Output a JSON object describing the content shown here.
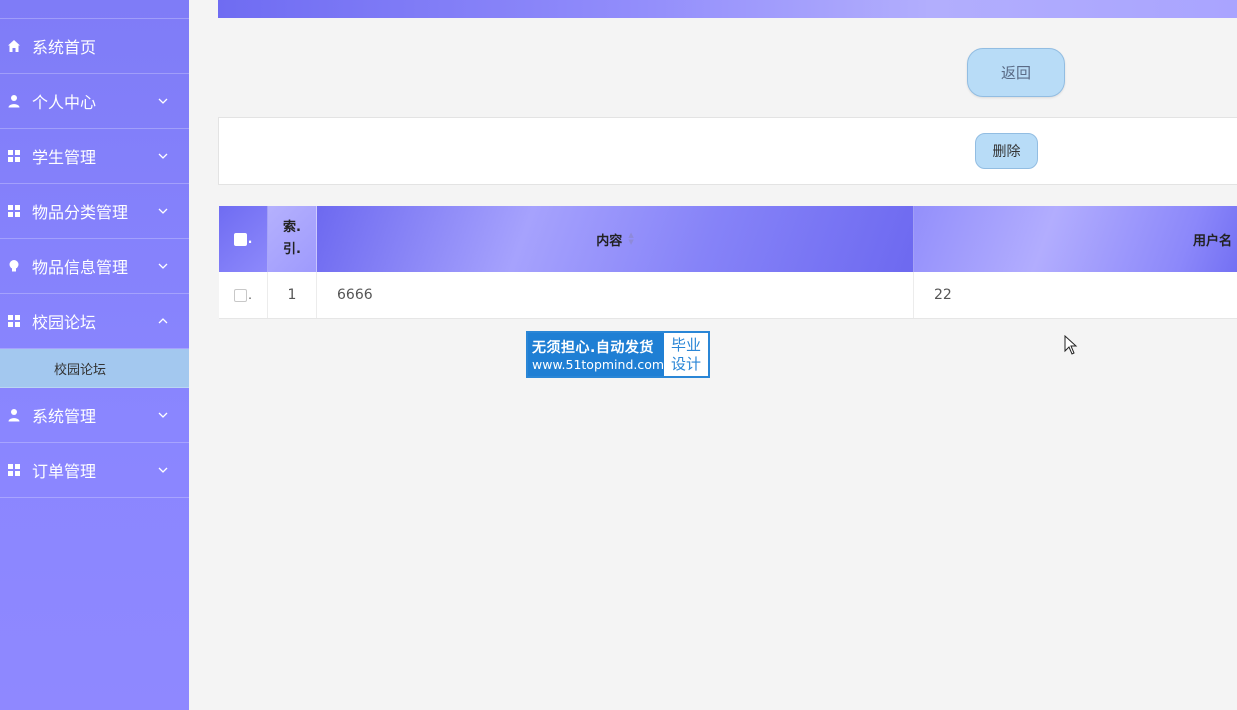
{
  "sidebar": {
    "items": [
      {
        "label": "系统首页",
        "icon": "home-icon",
        "expandable": false
      },
      {
        "label": "个人中心",
        "icon": "user-icon",
        "expandable": true
      },
      {
        "label": "学生管理",
        "icon": "grid-icon",
        "expandable": true
      },
      {
        "label": "物品分类管理",
        "icon": "grid-icon",
        "expandable": true
      },
      {
        "label": "物品信息管理",
        "icon": "bulb-icon",
        "expandable": true
      },
      {
        "label": "校园论坛",
        "icon": "grid-icon",
        "expandable": true,
        "expanded": true,
        "children": [
          {
            "label": "校园论坛"
          }
        ]
      },
      {
        "label": "系统管理",
        "icon": "user-icon",
        "expandable": true
      },
      {
        "label": "订单管理",
        "icon": "grid-icon",
        "expandable": true
      }
    ]
  },
  "actions": {
    "back_label": "返回",
    "delete_label": "删除"
  },
  "table": {
    "header_check_suffix": ".",
    "columns": {
      "index_line1": "索.",
      "index_line2": "引.",
      "content": "内容",
      "username": "用户名"
    },
    "rows": [
      {
        "check_suffix": ".",
        "index": "1",
        "content": "6666",
        "username": "22"
      }
    ]
  },
  "watermark": {
    "line1": "无须担心.自动发货",
    "line2": "www.51topmind.com",
    "right_line1": "毕业",
    "right_line2": "设计"
  },
  "colors": {
    "sidebar": "#8a86ff",
    "submenu_active": "#a3c8ef",
    "button": "#b8dcf7",
    "watermark_blue": "#1f7fd4"
  }
}
